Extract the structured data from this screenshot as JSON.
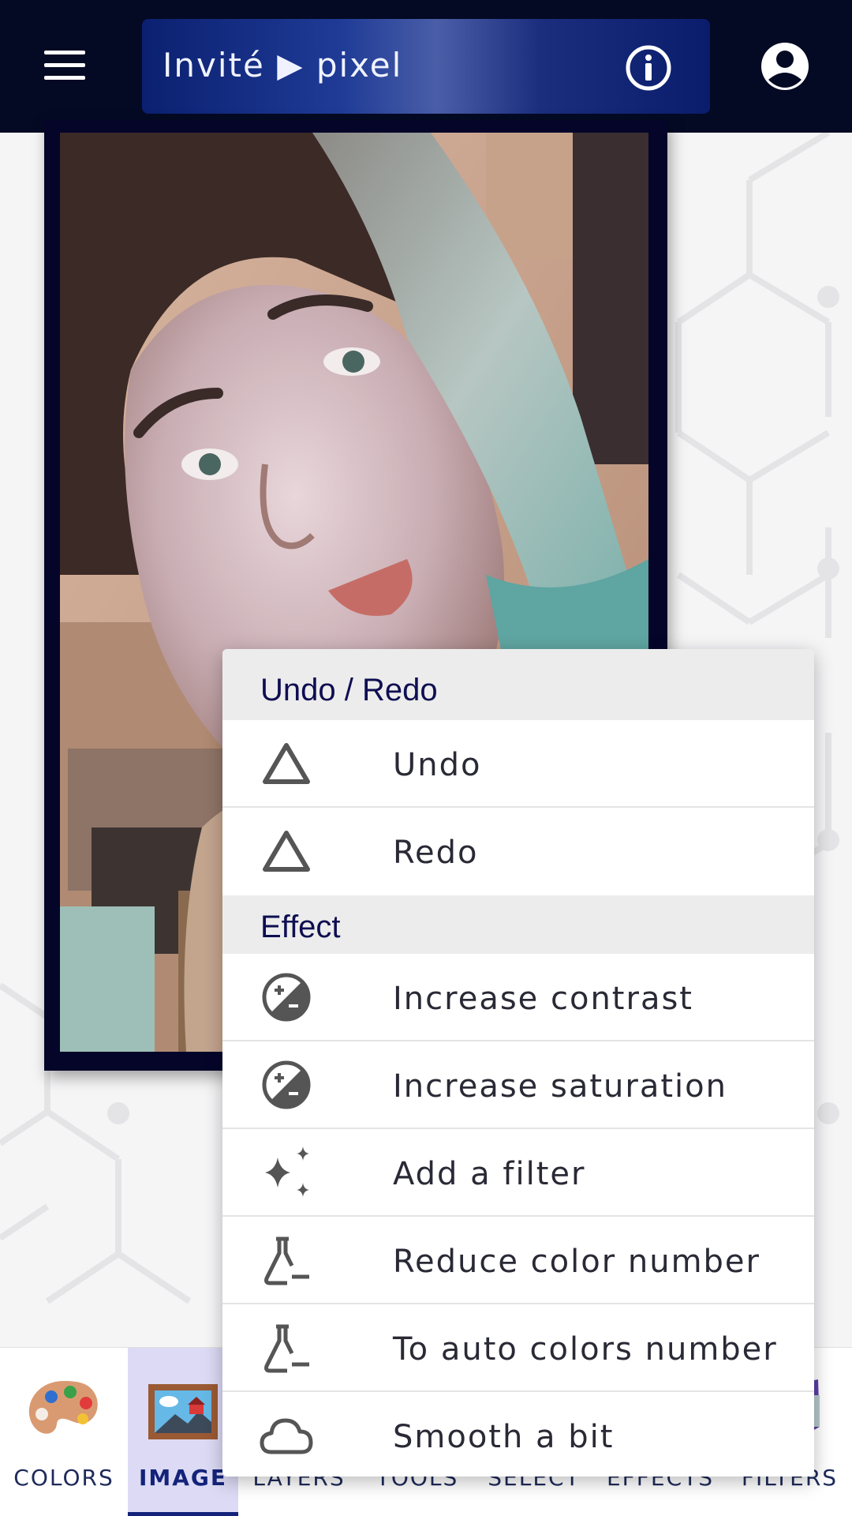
{
  "header": {
    "title": "Invité ▶ pixel",
    "menu_icon": "hamburger-icon",
    "info_icon": "info-icon",
    "profile_icon": "account-circle-icon"
  },
  "canvas": {
    "description_icon": "portrait-photo"
  },
  "popup": {
    "sections": [
      {
        "title": "Undo / Redo",
        "items": [
          {
            "label": "Undo",
            "icon": "triangle-icon"
          },
          {
            "label": "Redo",
            "icon": "triangle-icon"
          }
        ]
      },
      {
        "title": "Effect",
        "items": [
          {
            "label": "Increase contrast",
            "icon": "contrast-icon"
          },
          {
            "label": "Increase saturation",
            "icon": "contrast-icon"
          },
          {
            "label": "Add a filter",
            "icon": "sparkles-icon"
          },
          {
            "label": "Reduce color number",
            "icon": "flask-minus-icon"
          },
          {
            "label": "To auto colors number",
            "icon": "flask-minus-icon"
          },
          {
            "label": "Smooth a bit",
            "icon": "cloud-icon"
          }
        ]
      }
    ]
  },
  "bottom_nav": {
    "items": [
      {
        "label": "COLORS",
        "icon": "palette-icon"
      },
      {
        "label": "IMAGE",
        "icon": "framed-picture-icon",
        "active": true
      },
      {
        "label": "LAYERS",
        "icon": "layers-icon"
      },
      {
        "label": "TOOLS",
        "icon": "tools-icon"
      },
      {
        "label": "SELECT",
        "icon": "select-icon"
      },
      {
        "label": "EFFECTS",
        "icon": "effects-icon"
      },
      {
        "label": "FILTERS",
        "icon": "filters-icon"
      }
    ]
  },
  "colors": {
    "header_bg": "#040a24",
    "accent": "#13237a",
    "active_tab_bg": "#dcdaf4",
    "section_header_bg": "#ececec"
  }
}
